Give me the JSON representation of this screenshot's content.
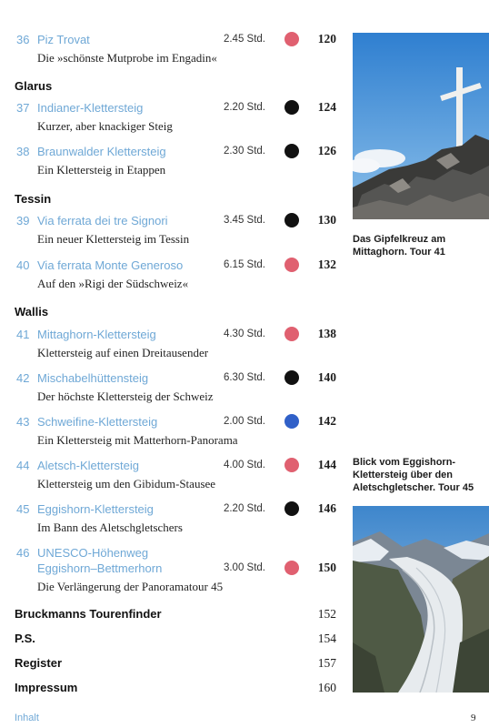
{
  "entries": [
    {
      "num": "36",
      "title": "Piz Trovat",
      "time": "2.45 Std.",
      "dot_color": "#e06070",
      "page": "120",
      "desc": "Die »schönste Mutprobe im Engadin«"
    },
    {
      "num": "37",
      "title": "Indianer-Klettersteig",
      "time": "2.20 Std.",
      "dot_color": "#111111",
      "page": "124",
      "desc": "Kurzer, aber knackiger Steig"
    },
    {
      "num": "38",
      "title": "Braunwalder Klettersteig",
      "time": "2.30 Std.",
      "dot_color": "#111111",
      "page": "126",
      "desc": "Ein Klettersteig in Etappen"
    },
    {
      "num": "39",
      "title": "Via ferrata dei tre Signori",
      "time": "3.45 Std.",
      "dot_color": "#111111",
      "page": "130",
      "desc": "Ein neuer Klettersteig im Tessin"
    },
    {
      "num": "40",
      "title": "Via ferrata Monte Generoso",
      "time": "6.15 Std.",
      "dot_color": "#e06070",
      "page": "132",
      "desc": "Auf den »Rigi der Südschweiz«"
    },
    {
      "num": "41",
      "title": "Mittaghorn-Klettersteig",
      "time": "4.30 Std.",
      "dot_color": "#e06070",
      "page": "138",
      "desc": "Klettersteig auf einen Dreitausender"
    },
    {
      "num": "42",
      "title": "Mischabelhüttensteig",
      "time": "6.30 Std.",
      "dot_color": "#111111",
      "page": "140",
      "desc": "Der höchste Klettersteig der Schweiz"
    },
    {
      "num": "43",
      "title": "Schweifine-Klettersteig",
      "time": "2.00 Std.",
      "dot_color": "#3060c8",
      "page": "142",
      "desc": "Ein Klettersteig mit Matterhorn-Panorama"
    },
    {
      "num": "44",
      "title": "Aletsch-Klettersteig",
      "time": "4.00 Std.",
      "dot_color": "#e06070",
      "page": "144",
      "desc": "Klettersteig um den Gibidum-Stausee"
    },
    {
      "num": "45",
      "title": "Eggishorn-Klettersteig",
      "time": "2.20 Std.",
      "dot_color": "#111111",
      "page": "146",
      "desc": "Im Bann des Aletschgletschers"
    },
    {
      "num": "46",
      "title": "UNESCO-Höhenweg",
      "title2": "Eggishorn–Bettmerhorn",
      "time": "3.00 Std.",
      "dot_color": "#e06070",
      "page": "150",
      "desc": "Die Verlängerung der Panoramatour 45"
    }
  ],
  "regions": {
    "glarus": "Glarus",
    "tessin": "Tessin",
    "wallis": "Wallis"
  },
  "sections": [
    {
      "title": "Bruckmanns Tourenfinder",
      "page": "152"
    },
    {
      "title": "P.S.",
      "page": "154"
    },
    {
      "title": "Register",
      "page": "157"
    },
    {
      "title": "Impressum",
      "page": "160"
    }
  ],
  "captions": {
    "photo1": "Das Gipfelkreuz am Mittaghorn. Tour 41",
    "photo2": "Blick vom Eggishorn-Klettersteig über den Aletschgletscher. Tour 45"
  },
  "footer": {
    "section": "Inhalt",
    "page_number": "9"
  }
}
